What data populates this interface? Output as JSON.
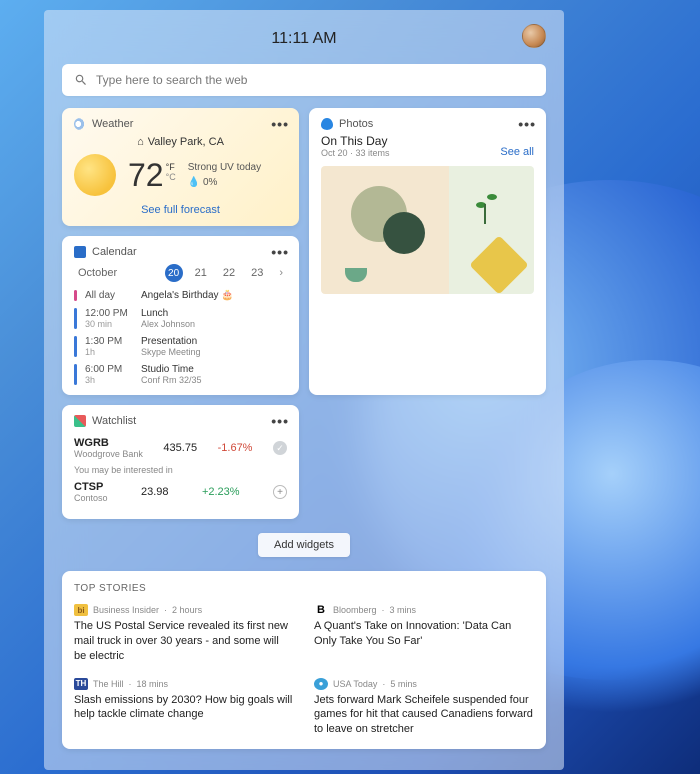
{
  "clock": "11:11 AM",
  "search": {
    "placeholder": "Type here to search the web"
  },
  "weather": {
    "title": "Weather",
    "location": "Valley Park, CA",
    "temp": "72",
    "unit_f": "°F",
    "unit_c": "°C",
    "detail1": "Strong UV today",
    "detail2": "0%",
    "forecast_link": "See full forecast"
  },
  "calendar": {
    "title": "Calendar",
    "month": "October",
    "dates": [
      "20",
      "21",
      "22",
      "23"
    ],
    "nav": "›",
    "events": [
      {
        "bar": "#d64a8a",
        "time": "All day",
        "dur": "",
        "name": "Angela's Birthday 🎂",
        "sub": ""
      },
      {
        "bar": "#3a78d8",
        "time": "12:00 PM",
        "dur": "30 min",
        "name": "Lunch",
        "sub": "Alex Johnson"
      },
      {
        "bar": "#3a78d8",
        "time": "1:30 PM",
        "dur": "1h",
        "name": "Presentation",
        "sub": "Skype Meeting"
      },
      {
        "bar": "#3a78d8",
        "time": "6:00 PM",
        "dur": "3h",
        "name": "Studio Time",
        "sub": "Conf Rm 32/35"
      }
    ]
  },
  "photos": {
    "title": "Photos",
    "heading": "On This Day",
    "meta": "Oct 20 · 33 items",
    "see_all": "See all"
  },
  "watchlist": {
    "title": "Watchlist",
    "stocks": [
      {
        "sym": "WGRB",
        "co": "Woodgrove Bank",
        "price": "435.75",
        "chg": "-1.67%",
        "cls": "chg-neg",
        "badge": "✓"
      },
      {
        "note": "You may be interested in"
      },
      {
        "sym": "CTSP",
        "co": "Contoso",
        "price": "23.98",
        "chg": "+2.23%",
        "cls": "chg-pos",
        "badge": "+"
      }
    ]
  },
  "add_widgets": "Add widgets",
  "stories": {
    "head": "TOP STORIES",
    "items": [
      {
        "src": "Business Insider",
        "src_color": "#f0c040",
        "src_initial": "bi",
        "time": "2 hours",
        "headline": "The US Postal Service revealed its first new mail truck in over 30 years - and some will be electric"
      },
      {
        "src": "Bloomberg",
        "src_color": "#000",
        "src_initial": "B",
        "time": "3 mins",
        "headline": "A Quant's Take on Innovation: 'Data Can Only Take You So Far'"
      },
      {
        "src": "The Hill",
        "src_color": "#2a4a9a",
        "src_initial": "TH",
        "time": "18 mins",
        "headline": "Slash emissions by 2030? How big goals will help tackle climate change"
      },
      {
        "src": "USA Today",
        "src_color": "#3aa0d8",
        "src_initial": "●",
        "time": "5 mins",
        "headline": "Jets forward Mark Scheifele suspended four games for hit that caused Canadiens forward to leave on stretcher"
      }
    ]
  }
}
